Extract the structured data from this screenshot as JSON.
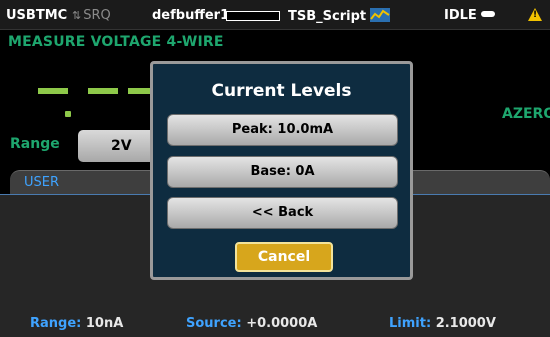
{
  "status_bar": {
    "interface": "USBTMC",
    "srq": "SRQ",
    "buffer": "defbuffer1",
    "script": "TSB_Script",
    "state": "IDLE",
    "icons": [
      "srq-arrows-icon",
      "script-icon",
      "idle-icon",
      "warning-icon"
    ],
    "warning_color": "#f2c200"
  },
  "function_title": "MEASURE VOLTAGE 4-WIRE",
  "reading": {
    "autozero": "AZERO"
  },
  "range": {
    "label": "Range",
    "value": "2V"
  },
  "user_panel": {
    "tab": "USER",
    "range_key": "Range:",
    "range_value": "10nA",
    "source_key": "Source:",
    "source_value": "+0.0000A",
    "limit_key": "Limit:",
    "limit_value": "2.1000V"
  },
  "dialog": {
    "title": "Current Levels",
    "buttons": [
      {
        "label": "Peak: 10.0mA"
      },
      {
        "label": "Base: 0A"
      },
      {
        "label": "<< Back"
      }
    ],
    "cancel": "Cancel"
  },
  "colors": {
    "accent_green": "#1ea66e",
    "reading_green": "#8ec94a",
    "label_blue": "#3fa3ff",
    "dialog_bg": "#0e2c40",
    "cancel_gold": "#d7a61c"
  }
}
